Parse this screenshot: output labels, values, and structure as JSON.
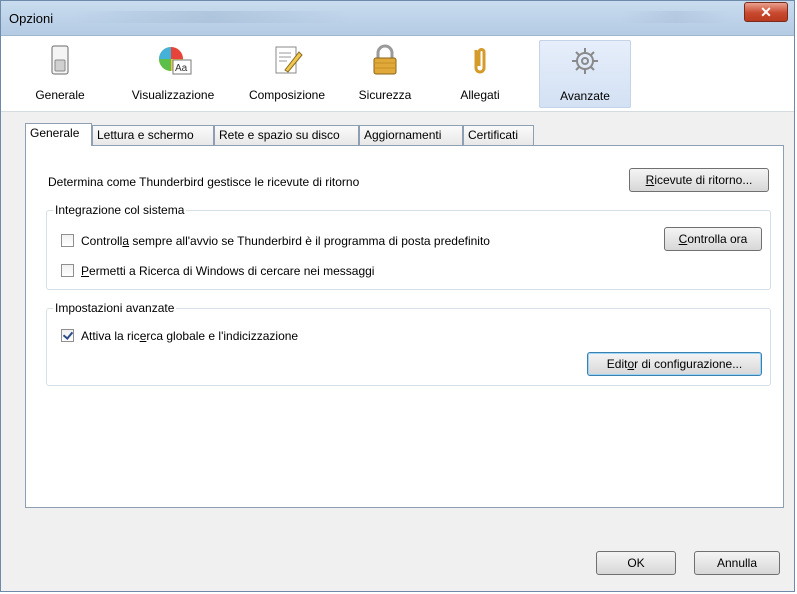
{
  "window": {
    "title": "Opzioni",
    "close_glyph": "✕"
  },
  "categories": [
    {
      "label": "Generale",
      "icon": "switch-icon"
    },
    {
      "label": "Visualizzazione",
      "icon": "palette-aa-icon"
    },
    {
      "label": "Composizione",
      "icon": "compose-pencil-icon"
    },
    {
      "label": "Sicurezza",
      "icon": "padlock-icon"
    },
    {
      "label": "Allegati",
      "icon": "paperclip-icon"
    },
    {
      "label": "Avanzate",
      "icon": "gear-icon",
      "selected": true
    }
  ],
  "tabs": [
    {
      "label": "Generale",
      "active": true
    },
    {
      "label": "Lettura e schermo"
    },
    {
      "label": "Rete e spazio su disco"
    },
    {
      "label": "Aggiornamenti"
    },
    {
      "label": "Certificati"
    }
  ],
  "panel": {
    "receipts_text": "Determina come Thunderbird gestisce le ricevute di ritorno",
    "receipts_button": "Ricevute di ritorno...",
    "integration": {
      "title": "Integrazione col sistema",
      "check_default_label_pre": "Controll",
      "check_default_label_u": "a",
      "check_default_label_post": " sempre all'avvio se Thunderbird è il programma di posta predefinito",
      "check_default_checked": false,
      "check_now_button": "Controlla ora",
      "windows_search_label_u": "P",
      "windows_search_label_post": "ermetti a Ricerca di Windows di cercare nei messaggi",
      "windows_search_checked": false
    },
    "advanced": {
      "title": "Impostazioni avanzate",
      "global_search_label_pre": "Attiva la ric",
      "global_search_label_u": "e",
      "global_search_label_post": "rca globale e l'indicizzazione",
      "global_search_checked": true,
      "config_editor_button_pre": "Edit",
      "config_editor_button_u": "o",
      "config_editor_button_post": "r di configurazione..."
    }
  },
  "footer": {
    "ok": "OK",
    "cancel": "Annulla"
  }
}
